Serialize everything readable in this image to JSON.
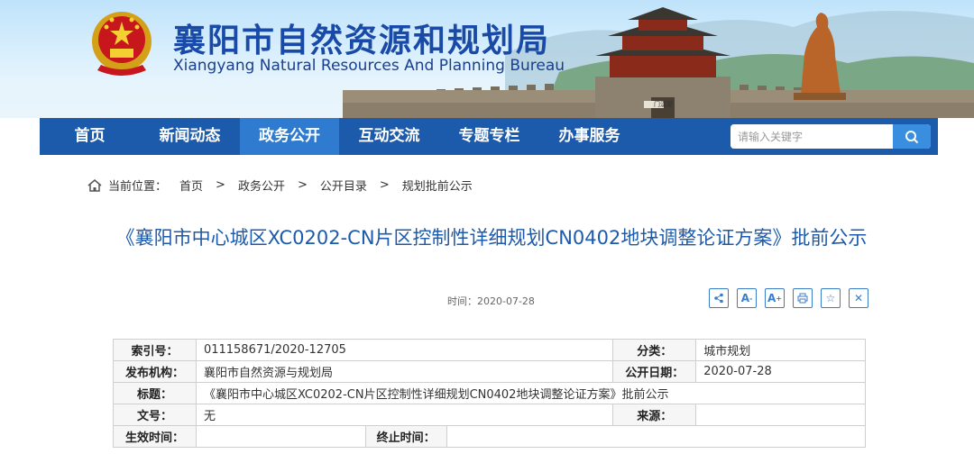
{
  "header": {
    "title_cn": "襄阳市自然资源和规划局",
    "title_en": "Xiangyang Natural Resources And Planning Bureau",
    "gate_sign": "门漢聚",
    "emblem_icon": "national-emblem-icon",
    "colors": {
      "brand": "#1a4aa8",
      "nav": "#1c5aab",
      "nav_active": "#2e7bd0"
    }
  },
  "nav": {
    "items": [
      {
        "label": "首页"
      },
      {
        "label": "新闻动态"
      },
      {
        "label": "政务公开"
      },
      {
        "label": "互动交流"
      },
      {
        "label": "专题专栏"
      },
      {
        "label": "办事服务"
      }
    ],
    "search_placeholder": "请输入关键字"
  },
  "breadcrumb": {
    "prefix": "当前位置：",
    "items": [
      "首页",
      "政务公开",
      "公开目录",
      "规划批前公示"
    ],
    "separator": ">"
  },
  "article": {
    "title": "《襄阳市中心城区XC0202-CN片区控制性详细规划CN0402地块调整论证方案》批前公示",
    "date": "时间：2020-07-28",
    "tools": [
      "share-icon",
      "font-smaller-icon",
      "font-larger-icon",
      "print-icon",
      "favorite-icon",
      "close-icon"
    ]
  },
  "info_table": {
    "index_label": "索引号：",
    "index_value": "011158671/2020-12705",
    "category_label": "分类：",
    "category_value": "城市规划",
    "publisher_label": "发布机构：",
    "publisher_value": "襄阳市自然资源与规划局",
    "pubdate_label": "公开日期：",
    "pubdate_value": "2020-07-28",
    "title_label": "标题：",
    "title_value": "《襄阳市中心城区XC0202-CN片区控制性详细规划CN0402地块调整论证方案》批前公示",
    "docno_label": "文号：",
    "docno_value": "无",
    "source_label": "来源：",
    "source_value": "",
    "effective_label": "生效时间：",
    "effective_value": "",
    "expire_label": "终止时间：",
    "expire_value": ""
  }
}
